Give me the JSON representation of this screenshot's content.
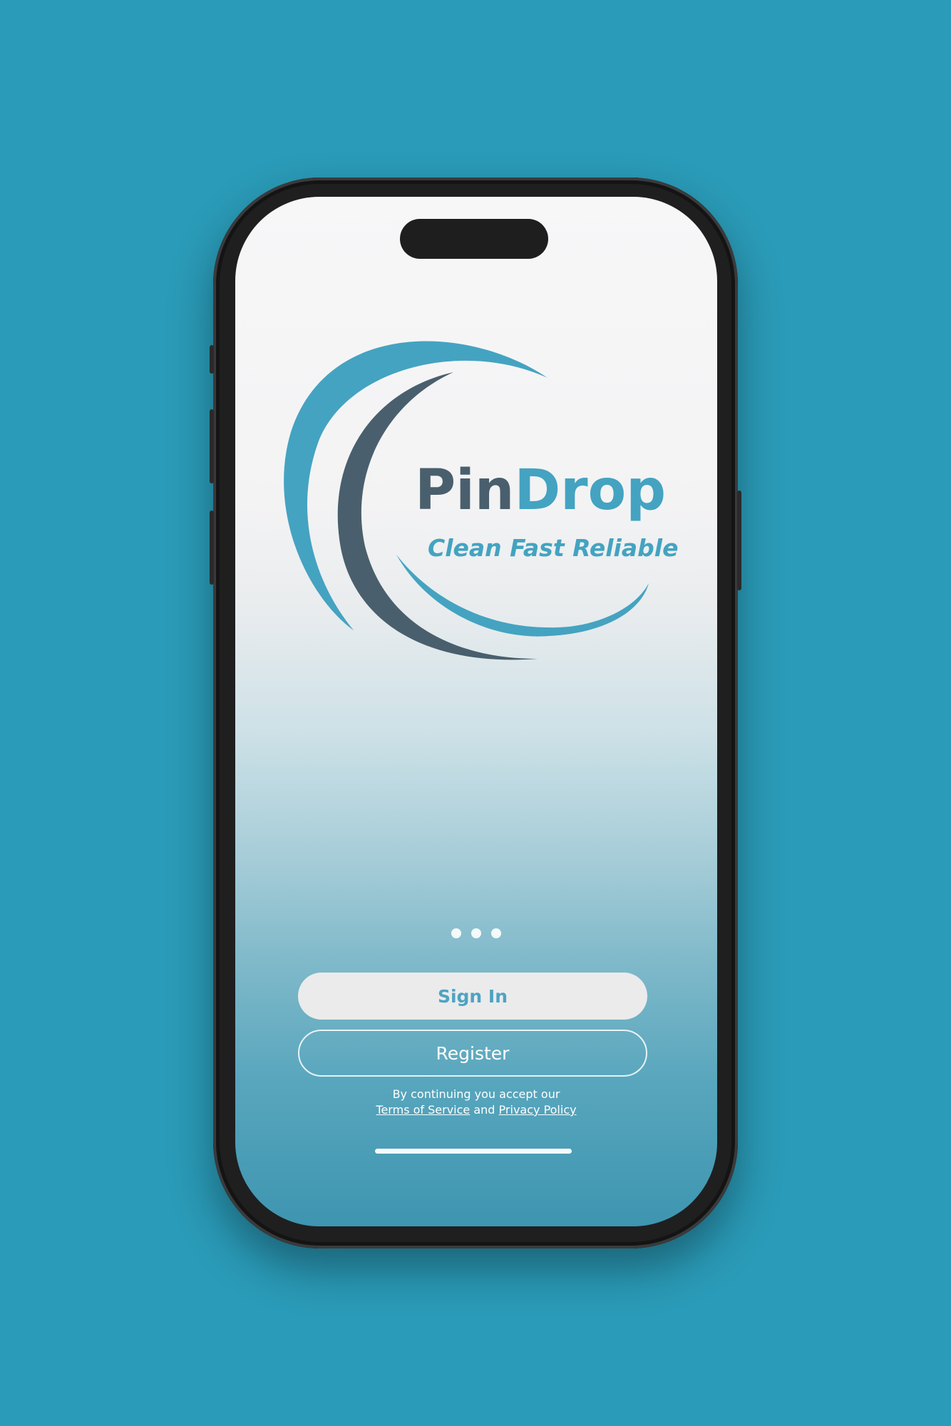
{
  "brand": {
    "name_part1": "Pin",
    "name_part2": "Drop",
    "tagline": "Clean Fast Reliable"
  },
  "colors": {
    "background": "#2a9bb8",
    "brand_teal": "#44a3c1",
    "brand_slate": "#4a5f6d",
    "sign_in_text": "#4ea3c2"
  },
  "pagination": {
    "count": 3
  },
  "actions": {
    "sign_in_label": "Sign In",
    "register_label": "Register"
  },
  "legal": {
    "prefix": "By continuing you accept our",
    "terms_label": "Terms of Service",
    "and": "and",
    "privacy_label": "Privacy Policy"
  }
}
